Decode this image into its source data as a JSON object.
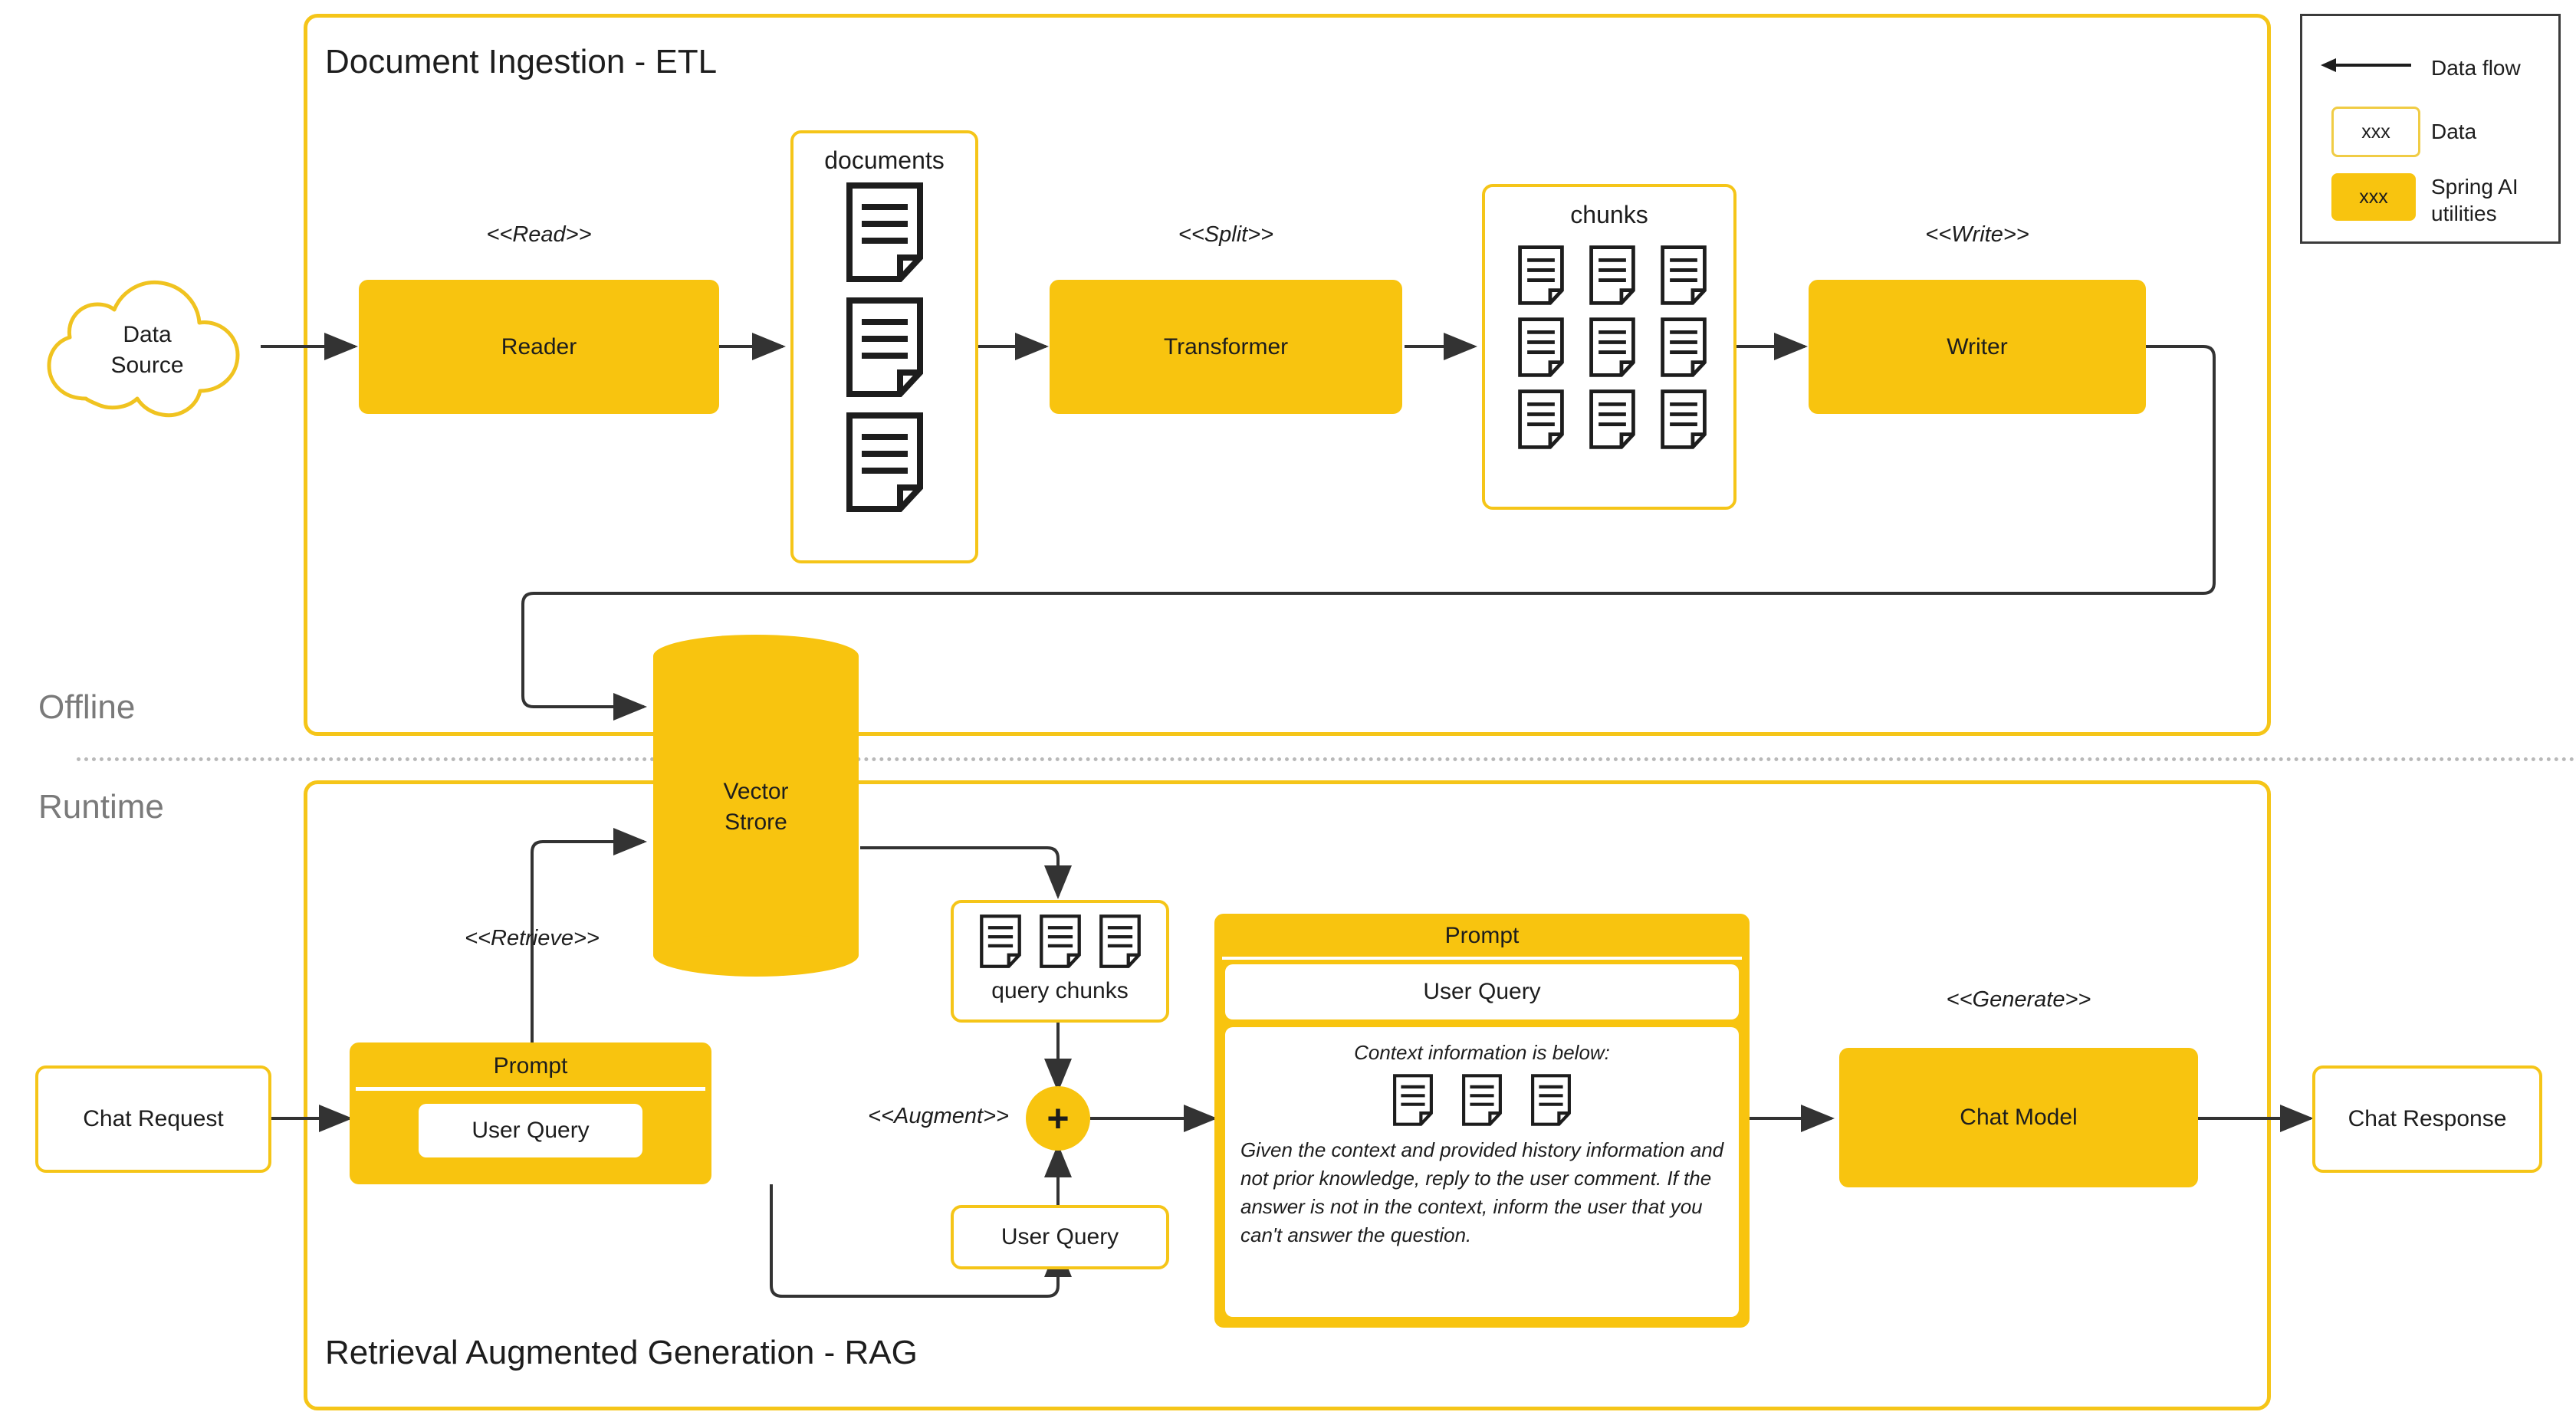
{
  "legend": {
    "arrow_label": "Data flow",
    "data_swatch_text": "xxx",
    "data_label": "Data",
    "util_swatch_text": "xxx",
    "util_label": "Spring AI utilities",
    "colors": {
      "accent": "#F8C40F",
      "data_border": "#F5C518",
      "line": "#333333",
      "muted": "#7a7a7a"
    }
  },
  "phases": {
    "offline_label": "Offline",
    "runtime_label": "Runtime",
    "etl_title": "Document Ingestion - ETL",
    "rag_title": "Retrieval Augmented Generation - RAG"
  },
  "etl": {
    "data_source": "Data\nSource",
    "data_source_line1": "Data",
    "data_source_line2": "Source",
    "read_stereotype": "<<Read>>",
    "reader": "Reader",
    "documents_label": "documents",
    "documents_count": 3,
    "split_stereotype": "<<Split>>",
    "transformer": "Transformer",
    "chunks_label": "chunks",
    "chunks_count": 9,
    "write_stereotype": "<<Write>>",
    "writer": "Writer"
  },
  "store": {
    "line1": "Vector",
    "line2": "Strore"
  },
  "rag": {
    "chat_request": "Chat Request",
    "retrieve_stereotype": "<<Retrieve>>",
    "left_prompt_header": "Prompt",
    "left_prompt_user_query": "User Query",
    "query_chunks_label": "query chunks",
    "query_chunks_count": 3,
    "augment_stereotype": "<<Augment>>",
    "plus_symbol": "+",
    "user_query_box": "User Query",
    "prompt_header": "Prompt",
    "prompt_user_query": "User Query",
    "context_heading": "Context information is below:",
    "context_docs_count": 3,
    "prompt_instruction": "Given the context and provided history information and not prior knowledge, reply to the user comment. If the answer is not in the context, inform the user that you can't answer the question.",
    "generate_stereotype": "<<Generate>>",
    "chat_model": "Chat Model",
    "chat_response": "Chat Response"
  }
}
